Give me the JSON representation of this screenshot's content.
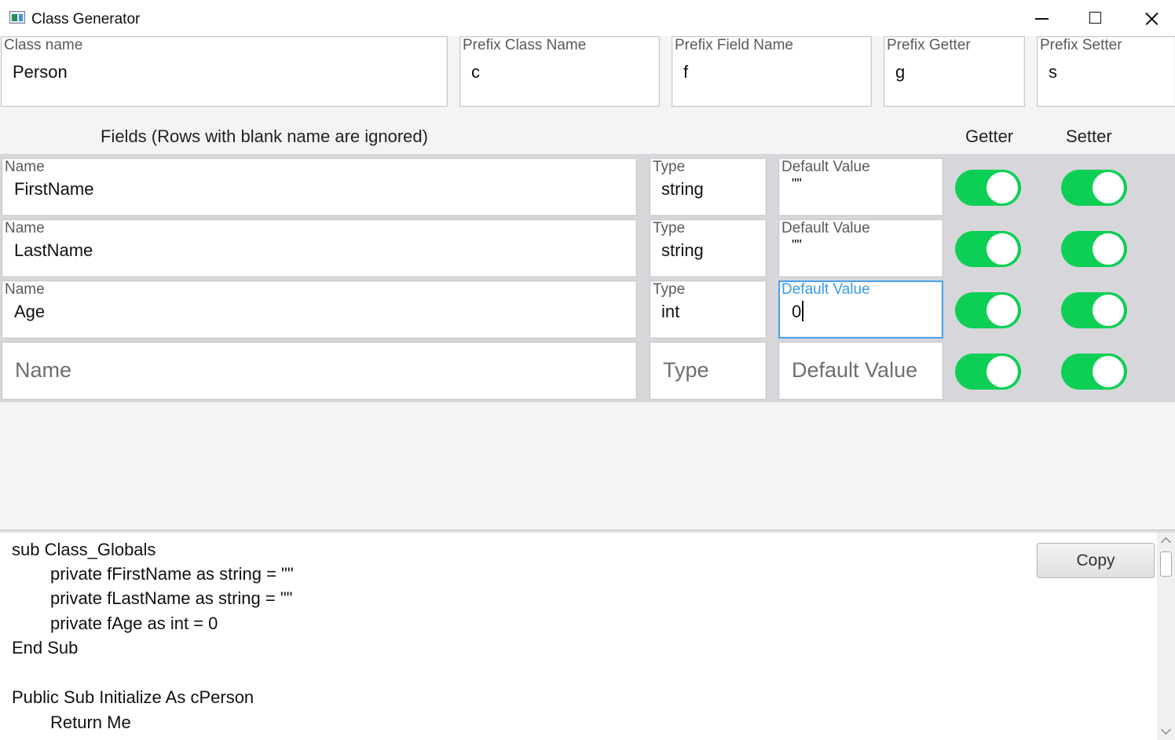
{
  "window": {
    "title": "Class Generator",
    "minimize_icon": "minimize-icon",
    "maximize_icon": "maximize-icon",
    "close_icon": "close-icon"
  },
  "settings": {
    "class_name": {
      "label": "Class name",
      "value": "Person"
    },
    "prefix_class_name": {
      "label": "Prefix Class Name",
      "value": "c"
    },
    "prefix_field_name": {
      "label": "Prefix Field Name",
      "value": "f"
    },
    "prefix_getter": {
      "label": "Prefix Getter",
      "value": "g"
    },
    "prefix_setter": {
      "label": "Prefix Setter",
      "value": "s"
    }
  },
  "fields_header": {
    "title": "Fields (Rows with blank name are ignored)",
    "getter": "Getter",
    "setter": "Setter"
  },
  "field_rows": [
    {
      "name_label": "Name",
      "name": "FirstName",
      "type_label": "Type",
      "type": "string",
      "default_label": "Default Value",
      "default": "\"\"",
      "getter": true,
      "setter": true
    },
    {
      "name_label": "Name",
      "name": "LastName",
      "type_label": "Type",
      "type": "string",
      "default_label": "Default Value",
      "default": "\"\"",
      "getter": true,
      "setter": true
    },
    {
      "name_label": "Name",
      "name": "Age",
      "type_label": "Type",
      "type": "int",
      "default_label": "Default Value",
      "default": "0",
      "getter": true,
      "setter": true,
      "focused": "default"
    }
  ],
  "empty_row": {
    "name_placeholder": "Name",
    "type_placeholder": "Type",
    "default_placeholder": "Default Value",
    "getter": true,
    "setter": true
  },
  "output": {
    "copy_label": "Copy",
    "lines": [
      "sub Class_Globals",
      "private fFirstName as string = \"\"",
      "private fLastName as string = \"\"",
      "private fAge as int = 0",
      "End Sub",
      "",
      "Public Sub Initialize As cPerson",
      "Return Me"
    ]
  },
  "colors": {
    "toggle_on": "#0ecf55",
    "focus_border": "#4aa3e8",
    "fields_panel_bg": "#d7d6db"
  }
}
